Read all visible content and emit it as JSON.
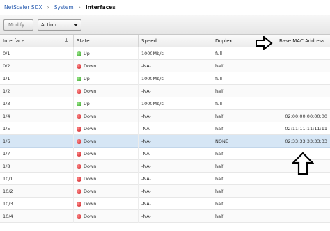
{
  "breadcrumb": {
    "items": [
      "NetScaler SDX",
      "System"
    ],
    "current": "Interfaces",
    "separator": "›"
  },
  "toolbar": {
    "modify_label": "Modify...",
    "action_label": "Action"
  },
  "table": {
    "columns": [
      "Interface",
      "State",
      "Speed",
      "Duplex",
      "Base MAC Address"
    ],
    "rows": [
      {
        "interface": "0/1",
        "state": "Up",
        "speed": "1000Mb/s",
        "duplex": "full",
        "mac": ""
      },
      {
        "interface": "0/2",
        "state": "Down",
        "speed": "-NA-",
        "duplex": "half",
        "mac": ""
      },
      {
        "interface": "1/1",
        "state": "Up",
        "speed": "1000Mb/s",
        "duplex": "full",
        "mac": ""
      },
      {
        "interface": "1/2",
        "state": "Down",
        "speed": "-NA-",
        "duplex": "half",
        "mac": ""
      },
      {
        "interface": "1/3",
        "state": "Up",
        "speed": "1000Mb/s",
        "duplex": "full",
        "mac": ""
      },
      {
        "interface": "1/4",
        "state": "Down",
        "speed": "-NA-",
        "duplex": "half",
        "mac": "02:00:00:00:00:00"
      },
      {
        "interface": "1/5",
        "state": "Down",
        "speed": "-NA-",
        "duplex": "half",
        "mac": "02:11:11:11:11:11"
      },
      {
        "interface": "1/6",
        "state": "Down",
        "speed": "-NA-",
        "duplex": "NONE",
        "mac": "02:33:33:33:33:33"
      },
      {
        "interface": "1/7",
        "state": "Down",
        "speed": "-NA-",
        "duplex": "half",
        "mac": ""
      },
      {
        "interface": "1/8",
        "state": "Down",
        "speed": "-NA-",
        "duplex": "half",
        "mac": ""
      },
      {
        "interface": "10/1",
        "state": "Down",
        "speed": "-NA-",
        "duplex": "half",
        "mac": ""
      },
      {
        "interface": "10/2",
        "state": "Down",
        "speed": "-NA-",
        "duplex": "half",
        "mac": ""
      },
      {
        "interface": "10/3",
        "state": "Down",
        "speed": "-NA-",
        "duplex": "half",
        "mac": ""
      },
      {
        "interface": "10/4",
        "state": "Down",
        "speed": "-NA-",
        "duplex": "half",
        "mac": ""
      }
    ],
    "selected_row": 7
  },
  "icons": {
    "up_state": "green-status-dot-icon",
    "down_state": "red-status-dot-icon",
    "sort": "sort-descending-arrow-icon",
    "annotation_right": "outline-arrow-right-icon",
    "annotation_up": "outline-arrow-up-icon"
  },
  "colors": {
    "link": "#2a5db0",
    "selected_row": "#d6e6f5",
    "up": "#2f9b1e",
    "down": "#c8161a"
  }
}
